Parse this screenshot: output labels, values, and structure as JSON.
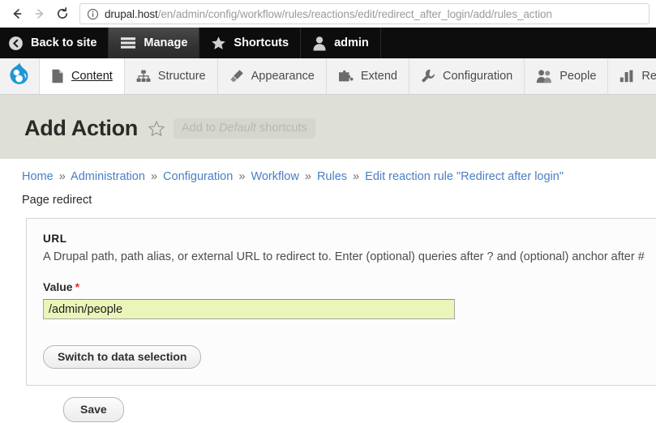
{
  "browser": {
    "back_icon": "arrow-left-icon",
    "forward_icon": "arrow-right-icon",
    "reload_icon": "reload-icon",
    "site_info_icon": "info-circle-icon",
    "url_domain": "drupal.host",
    "url_path": "/en/admin/config/workflow/rules/reactions/edit/redirect_after_login/add/rules_action",
    "url_full": "drupal.host/en/admin/config/workflow/rules/reactions/edit/redirect_after_login/add/rules_action"
  },
  "admin_toolbar": {
    "background": "#0d0d0d",
    "items": [
      {
        "label": "Back to site",
        "icon": "back-circle-icon",
        "active": false
      },
      {
        "label": "Manage",
        "icon": "hamburger-icon",
        "active": true
      },
      {
        "label": "Shortcuts",
        "icon": "star-icon",
        "active": false
      },
      {
        "label": "admin",
        "icon": "user-icon",
        "active": false
      }
    ]
  },
  "admin_menu": {
    "brand_icon": "drupal-logo-icon",
    "brand_color": "#2196d4",
    "items": [
      {
        "label": "Content",
        "icon": "page-icon",
        "active": true
      },
      {
        "label": "Structure",
        "icon": "sitemap-icon",
        "active": false
      },
      {
        "label": "Appearance",
        "icon": "paintbrush-icon",
        "active": false
      },
      {
        "label": "Extend",
        "icon": "puzzle-icon",
        "active": false
      },
      {
        "label": "Configuration",
        "icon": "wrench-icon",
        "active": false
      },
      {
        "label": "People",
        "icon": "people-icon",
        "active": false
      },
      {
        "label": "Repo",
        "icon": "bar-chart-icon",
        "active": false
      }
    ]
  },
  "page": {
    "title": "Add Action",
    "header_background": "#dee0d8",
    "shortcut_prefix": "Add to ",
    "shortcut_emphasis": "Default",
    "shortcut_suffix": " shortcuts",
    "star_icon": "star-outline-icon"
  },
  "breadcrumb": {
    "separator": "»",
    "items": [
      "Home",
      "Administration",
      "Configuration",
      "Workflow",
      "Rules",
      "Edit reaction rule \"Redirect after login\""
    ],
    "link_color": "#4a7ec4"
  },
  "subtitle": "Page redirect",
  "form": {
    "fieldset_legend": "URL",
    "fieldset_description": "A Drupal path, path alias, or external URL to redirect to. Enter (optional) queries after ? and (optional) anchor after #",
    "value_label": "Value",
    "required_marker": "*",
    "value_input": "/admin/people",
    "value_input_placeholder": "",
    "value_input_background": "#eaf5b9",
    "switch_button": "Switch to data selection",
    "save_button": "Save"
  }
}
